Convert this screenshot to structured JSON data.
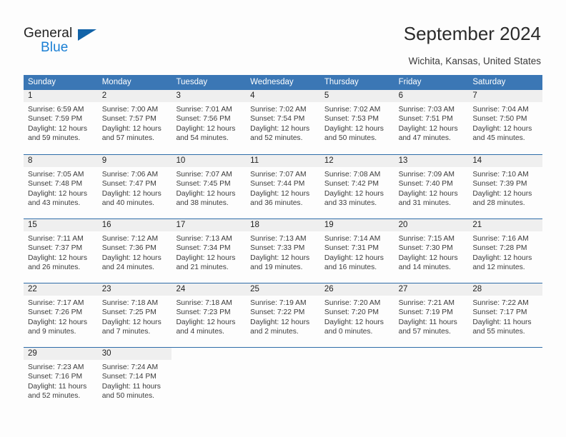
{
  "brand": {
    "name_top": "General",
    "name_bottom": "Blue",
    "triangle_color": "#1263a8",
    "blue_color": "#1a7fd4"
  },
  "header": {
    "title": "September 2024",
    "subtitle": "Wichita, Kansas, United States"
  },
  "theme": {
    "header_blue": "#3b77b5",
    "week_divider": "#2e6ca8",
    "daynum_band": "#efefef"
  },
  "weekdays": [
    "Sunday",
    "Monday",
    "Tuesday",
    "Wednesday",
    "Thursday",
    "Friday",
    "Saturday"
  ],
  "weeks": [
    [
      {
        "day": "1",
        "sunrise": "Sunrise: 6:59 AM",
        "sunset": "Sunset: 7:59 PM",
        "daylight1": "Daylight: 12 hours",
        "daylight2": "and 59 minutes."
      },
      {
        "day": "2",
        "sunrise": "Sunrise: 7:00 AM",
        "sunset": "Sunset: 7:57 PM",
        "daylight1": "Daylight: 12 hours",
        "daylight2": "and 57 minutes."
      },
      {
        "day": "3",
        "sunrise": "Sunrise: 7:01 AM",
        "sunset": "Sunset: 7:56 PM",
        "daylight1": "Daylight: 12 hours",
        "daylight2": "and 54 minutes."
      },
      {
        "day": "4",
        "sunrise": "Sunrise: 7:02 AM",
        "sunset": "Sunset: 7:54 PM",
        "daylight1": "Daylight: 12 hours",
        "daylight2": "and 52 minutes."
      },
      {
        "day": "5",
        "sunrise": "Sunrise: 7:02 AM",
        "sunset": "Sunset: 7:53 PM",
        "daylight1": "Daylight: 12 hours",
        "daylight2": "and 50 minutes."
      },
      {
        "day": "6",
        "sunrise": "Sunrise: 7:03 AM",
        "sunset": "Sunset: 7:51 PM",
        "daylight1": "Daylight: 12 hours",
        "daylight2": "and 47 minutes."
      },
      {
        "day": "7",
        "sunrise": "Sunrise: 7:04 AM",
        "sunset": "Sunset: 7:50 PM",
        "daylight1": "Daylight: 12 hours",
        "daylight2": "and 45 minutes."
      }
    ],
    [
      {
        "day": "8",
        "sunrise": "Sunrise: 7:05 AM",
        "sunset": "Sunset: 7:48 PM",
        "daylight1": "Daylight: 12 hours",
        "daylight2": "and 43 minutes."
      },
      {
        "day": "9",
        "sunrise": "Sunrise: 7:06 AM",
        "sunset": "Sunset: 7:47 PM",
        "daylight1": "Daylight: 12 hours",
        "daylight2": "and 40 minutes."
      },
      {
        "day": "10",
        "sunrise": "Sunrise: 7:07 AM",
        "sunset": "Sunset: 7:45 PM",
        "daylight1": "Daylight: 12 hours",
        "daylight2": "and 38 minutes."
      },
      {
        "day": "11",
        "sunrise": "Sunrise: 7:07 AM",
        "sunset": "Sunset: 7:44 PM",
        "daylight1": "Daylight: 12 hours",
        "daylight2": "and 36 minutes."
      },
      {
        "day": "12",
        "sunrise": "Sunrise: 7:08 AM",
        "sunset": "Sunset: 7:42 PM",
        "daylight1": "Daylight: 12 hours",
        "daylight2": "and 33 minutes."
      },
      {
        "day": "13",
        "sunrise": "Sunrise: 7:09 AM",
        "sunset": "Sunset: 7:40 PM",
        "daylight1": "Daylight: 12 hours",
        "daylight2": "and 31 minutes."
      },
      {
        "day": "14",
        "sunrise": "Sunrise: 7:10 AM",
        "sunset": "Sunset: 7:39 PM",
        "daylight1": "Daylight: 12 hours",
        "daylight2": "and 28 minutes."
      }
    ],
    [
      {
        "day": "15",
        "sunrise": "Sunrise: 7:11 AM",
        "sunset": "Sunset: 7:37 PM",
        "daylight1": "Daylight: 12 hours",
        "daylight2": "and 26 minutes."
      },
      {
        "day": "16",
        "sunrise": "Sunrise: 7:12 AM",
        "sunset": "Sunset: 7:36 PM",
        "daylight1": "Daylight: 12 hours",
        "daylight2": "and 24 minutes."
      },
      {
        "day": "17",
        "sunrise": "Sunrise: 7:13 AM",
        "sunset": "Sunset: 7:34 PM",
        "daylight1": "Daylight: 12 hours",
        "daylight2": "and 21 minutes."
      },
      {
        "day": "18",
        "sunrise": "Sunrise: 7:13 AM",
        "sunset": "Sunset: 7:33 PM",
        "daylight1": "Daylight: 12 hours",
        "daylight2": "and 19 minutes."
      },
      {
        "day": "19",
        "sunrise": "Sunrise: 7:14 AM",
        "sunset": "Sunset: 7:31 PM",
        "daylight1": "Daylight: 12 hours",
        "daylight2": "and 16 minutes."
      },
      {
        "day": "20",
        "sunrise": "Sunrise: 7:15 AM",
        "sunset": "Sunset: 7:30 PM",
        "daylight1": "Daylight: 12 hours",
        "daylight2": "and 14 minutes."
      },
      {
        "day": "21",
        "sunrise": "Sunrise: 7:16 AM",
        "sunset": "Sunset: 7:28 PM",
        "daylight1": "Daylight: 12 hours",
        "daylight2": "and 12 minutes."
      }
    ],
    [
      {
        "day": "22",
        "sunrise": "Sunrise: 7:17 AM",
        "sunset": "Sunset: 7:26 PM",
        "daylight1": "Daylight: 12 hours",
        "daylight2": "and 9 minutes."
      },
      {
        "day": "23",
        "sunrise": "Sunrise: 7:18 AM",
        "sunset": "Sunset: 7:25 PM",
        "daylight1": "Daylight: 12 hours",
        "daylight2": "and 7 minutes."
      },
      {
        "day": "24",
        "sunrise": "Sunrise: 7:18 AM",
        "sunset": "Sunset: 7:23 PM",
        "daylight1": "Daylight: 12 hours",
        "daylight2": "and 4 minutes."
      },
      {
        "day": "25",
        "sunrise": "Sunrise: 7:19 AM",
        "sunset": "Sunset: 7:22 PM",
        "daylight1": "Daylight: 12 hours",
        "daylight2": "and 2 minutes."
      },
      {
        "day": "26",
        "sunrise": "Sunrise: 7:20 AM",
        "sunset": "Sunset: 7:20 PM",
        "daylight1": "Daylight: 12 hours",
        "daylight2": "and 0 minutes."
      },
      {
        "day": "27",
        "sunrise": "Sunrise: 7:21 AM",
        "sunset": "Sunset: 7:19 PM",
        "daylight1": "Daylight: 11 hours",
        "daylight2": "and 57 minutes."
      },
      {
        "day": "28",
        "sunrise": "Sunrise: 7:22 AM",
        "sunset": "Sunset: 7:17 PM",
        "daylight1": "Daylight: 11 hours",
        "daylight2": "and 55 minutes."
      }
    ],
    [
      {
        "day": "29",
        "sunrise": "Sunrise: 7:23 AM",
        "sunset": "Sunset: 7:16 PM",
        "daylight1": "Daylight: 11 hours",
        "daylight2": "and 52 minutes."
      },
      {
        "day": "30",
        "sunrise": "Sunrise: 7:24 AM",
        "sunset": "Sunset: 7:14 PM",
        "daylight1": "Daylight: 11 hours",
        "daylight2": "and 50 minutes."
      },
      {
        "day": "",
        "sunrise": "",
        "sunset": "",
        "daylight1": "",
        "daylight2": ""
      },
      {
        "day": "",
        "sunrise": "",
        "sunset": "",
        "daylight1": "",
        "daylight2": ""
      },
      {
        "day": "",
        "sunrise": "",
        "sunset": "",
        "daylight1": "",
        "daylight2": ""
      },
      {
        "day": "",
        "sunrise": "",
        "sunset": "",
        "daylight1": "",
        "daylight2": ""
      },
      {
        "day": "",
        "sunrise": "",
        "sunset": "",
        "daylight1": "",
        "daylight2": ""
      }
    ]
  ]
}
